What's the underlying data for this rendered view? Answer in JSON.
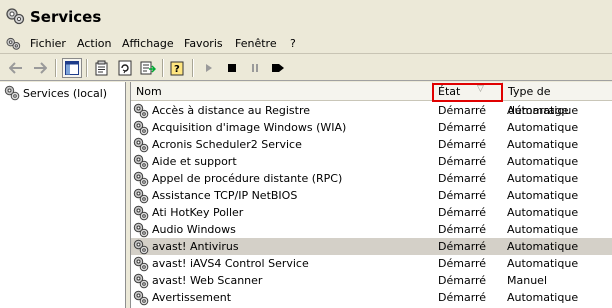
{
  "window": {
    "title": "Services"
  },
  "menu": {
    "items": [
      "Fichier",
      "Action",
      "Affichage",
      "Favoris",
      "Fenêtre",
      "?"
    ]
  },
  "toolbar": {
    "buttons": [
      "back-arrow-icon",
      "forward-arrow-icon",
      "show-hide-tree-icon",
      "properties-icon",
      "refresh-icon",
      "export-list-icon",
      "help-icon",
      "start-service-icon",
      "stop-service-icon",
      "pause-service-icon",
      "restart-service-icon"
    ]
  },
  "tree": {
    "root_label": "Services (local)"
  },
  "columns": {
    "name": "Nom",
    "state": "État",
    "startup": "Type de démarrage"
  },
  "services": [
    {
      "name": "Accès à distance au Registre",
      "state": "Démarré",
      "startup": "Automatique"
    },
    {
      "name": "Acquisition d'image Windows (WIA)",
      "state": "Démarré",
      "startup": "Automatique"
    },
    {
      "name": "Acronis Scheduler2 Service",
      "state": "Démarré",
      "startup": "Automatique"
    },
    {
      "name": "Aide et support",
      "state": "Démarré",
      "startup": "Automatique"
    },
    {
      "name": "Appel de procédure distante (RPC)",
      "state": "Démarré",
      "startup": "Automatique"
    },
    {
      "name": "Assistance TCP/IP NetBIOS",
      "state": "Démarré",
      "startup": "Automatique"
    },
    {
      "name": "Ati HotKey Poller",
      "state": "Démarré",
      "startup": "Automatique"
    },
    {
      "name": "Audio Windows",
      "state": "Démarré",
      "startup": "Automatique"
    },
    {
      "name": "avast! Antivirus",
      "state": "Démarré",
      "startup": "Automatique",
      "selected": true
    },
    {
      "name": "avast! iAVS4 Control Service",
      "state": "Démarré",
      "startup": "Automatique"
    },
    {
      "name": "avast! Web Scanner",
      "state": "Démarré",
      "startup": "Manuel"
    },
    {
      "name": "Avertissement",
      "state": "Démarré",
      "startup": "Automatique"
    }
  ],
  "colors": {
    "highlight_box": "#e00000",
    "selected_row": "#d4d0c8"
  }
}
